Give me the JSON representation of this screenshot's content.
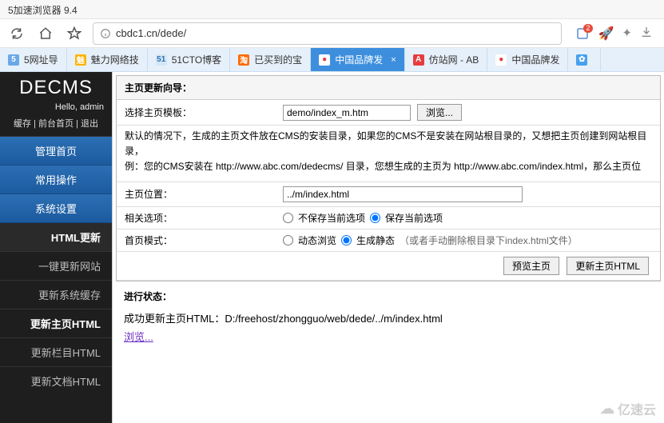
{
  "window": {
    "title": "5加速浏览器 9.4"
  },
  "addressbar": {
    "url": "cbdc1.cn/dede/"
  },
  "notification": {
    "count": "2"
  },
  "tabs": [
    {
      "label": "5网址导",
      "fav_bg": "#6aa8e8",
      "fav_text": "5",
      "fav_color": "#fff"
    },
    {
      "label": "魅力网络技",
      "fav_bg": "#ffb300",
      "fav_text": "魅",
      "fav_color": "#fff"
    },
    {
      "label": "51CTO博客",
      "fav_bg": "#d4e7f7",
      "fav_text": "51",
      "fav_color": "#2c6fb4"
    },
    {
      "label": "已买到的宝",
      "fav_bg": "#ff6a00",
      "fav_text": "淘",
      "fav_color": "#fff"
    },
    {
      "label": "中国品牌发",
      "fav_bg": "#ffffff",
      "fav_text": "●",
      "fav_color": "#e63c3c"
    },
    {
      "label": "仿站网 - AB",
      "fav_bg": "#e63c3c",
      "fav_text": "A",
      "fav_color": "#fff"
    },
    {
      "label": "中国品牌发",
      "fav_bg": "#ffffff",
      "fav_text": "●",
      "fav_color": "#e63c3c"
    },
    {
      "label": "",
      "fav_bg": "#48a0ee",
      "fav_text": "✿",
      "fav_color": "#fff"
    }
  ],
  "active_tab_index": 4,
  "sidebar": {
    "logo": "DECMS",
    "greeting": "Hello, admin",
    "toplinks": {
      "cache": "缓存",
      "front": "前台首页",
      "logout": "退出"
    },
    "groups": [
      "管理首页",
      "常用操作",
      "系统设置"
    ],
    "section": "HTML更新",
    "items": [
      "一键更新网站",
      "更新系统缓存",
      "更新主页HTML",
      "更新栏目HTML",
      "更新文档HTML"
    ],
    "active_item_index": 2
  },
  "panel": {
    "title": "主页更新向导：",
    "rows": {
      "template_label": "选择主页模板：",
      "template_value": "demo/index_m.htm",
      "browse_btn": "浏览...",
      "help1": "默认的情况下，生成的主页文件放在CMS的安装目录，如果您的CMS不是安装在网站根目录的，又想把主页创建到网站根目录，",
      "help2": "例：您的CMS安装在 http://www.abc.com/dedecms/ 目录，您想生成的主页为 http://www.abc.com/index.html，那么主页位",
      "position_label": "主页位置：",
      "position_value": "../m/index.html",
      "options_label": "相关选项：",
      "opt1": "不保存当前选项",
      "opt2": "保存当前选项",
      "mode_label": "首页模式：",
      "mode1": "动态浏览",
      "mode2": "生成静态",
      "mode_note": "（或者手动删除根目录下index.html文件）",
      "preview_btn": "预览主页",
      "update_btn": "更新主页HTML"
    },
    "status_title": "进行状态：",
    "status_msg": "成功更新主页HTML：D:/freehost/zhongguo/web/dede/../m/index.html",
    "status_link": "浏览..."
  },
  "watermark": "亿速云"
}
